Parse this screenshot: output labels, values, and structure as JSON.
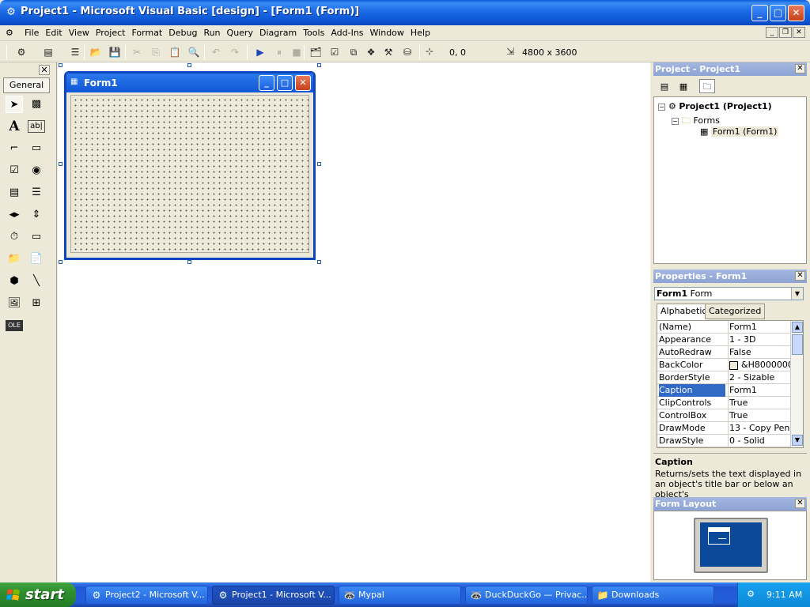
{
  "window": {
    "title": "Project1 - Microsoft Visual Basic [design] - [Form1 (Form)]",
    "controls": {
      "minimize": "_",
      "maximize": "□",
      "close": "✕"
    }
  },
  "menubar": {
    "items": [
      "File",
      "Edit",
      "View",
      "Project",
      "Format",
      "Debug",
      "Run",
      "Query",
      "Diagram",
      "Tools",
      "Add-Ins",
      "Window",
      "Help"
    ],
    "mdi": {
      "minimize": "_",
      "restore": "❐",
      "close": "✕"
    }
  },
  "toolbar": {
    "position": "0, 0",
    "size": "4800 x 3600",
    "buttons": [
      {
        "name": "add-project-icon",
        "glyph": "⚙"
      },
      {
        "name": "add-form-icon",
        "glyph": "▤"
      },
      {
        "name": "menu-editor-icon",
        "glyph": "☰"
      },
      {
        "name": "open-icon",
        "glyph": "📂"
      },
      {
        "name": "save-icon",
        "glyph": "💾"
      },
      {
        "name": "cut-icon",
        "glyph": "✂"
      },
      {
        "name": "copy-icon",
        "glyph": "⎘"
      },
      {
        "name": "paste-icon",
        "glyph": "📋"
      },
      {
        "name": "find-icon",
        "glyph": "🔍"
      },
      {
        "name": "undo-icon",
        "glyph": "↶"
      },
      {
        "name": "redo-icon",
        "glyph": "↷"
      },
      {
        "name": "start-icon",
        "glyph": "▶"
      },
      {
        "name": "break-icon",
        "glyph": "⏸"
      },
      {
        "name": "end-icon",
        "glyph": "■"
      },
      {
        "name": "project-explorer-icon",
        "glyph": "🗂"
      },
      {
        "name": "properties-window-icon",
        "glyph": "☑"
      },
      {
        "name": "form-layout-icon",
        "glyph": "⧉"
      },
      {
        "name": "object-browser-icon",
        "glyph": "❖"
      },
      {
        "name": "toolbox-icon",
        "glyph": "⚒"
      },
      {
        "name": "data-view-icon",
        "glyph": "⛁"
      }
    ]
  },
  "toolbox": {
    "close": "✕",
    "tab": "General",
    "tools": [
      {
        "name": "pointer-icon",
        "glyph": "➤"
      },
      {
        "name": "picturebox-icon",
        "glyph": "▩"
      },
      {
        "name": "label-icon",
        "glyph": "A"
      },
      {
        "name": "textbox-icon",
        "glyph": "ab|"
      },
      {
        "name": "frame-icon",
        "glyph": "⌐"
      },
      {
        "name": "commandbutton-icon",
        "glyph": "▭"
      },
      {
        "name": "checkbox-icon",
        "glyph": "☑"
      },
      {
        "name": "optionbutton-icon",
        "glyph": "◉"
      },
      {
        "name": "combobox-icon",
        "glyph": "▤"
      },
      {
        "name": "listbox-icon",
        "glyph": "☰"
      },
      {
        "name": "hscrollbar-icon",
        "glyph": "◂▸"
      },
      {
        "name": "vscrollbar-icon",
        "glyph": "⇕"
      },
      {
        "name": "timer-icon",
        "glyph": "⏱"
      },
      {
        "name": "drivelistbox-icon",
        "glyph": "▭"
      },
      {
        "name": "dirlistbox-icon",
        "glyph": "📁"
      },
      {
        "name": "filelistbox-icon",
        "glyph": "📄"
      },
      {
        "name": "shape-icon",
        "glyph": "⬢"
      },
      {
        "name": "line-icon",
        "glyph": "╲"
      },
      {
        "name": "image-icon",
        "glyph": "🖼"
      },
      {
        "name": "data-icon",
        "glyph": "⊞"
      },
      {
        "name": "ole-icon",
        "glyph": "OLE"
      }
    ]
  },
  "form_designer": {
    "title": "Form1",
    "controls": {
      "minimize": "_",
      "maximize": "□",
      "close": "✕"
    }
  },
  "project_panel": {
    "title": "Project - Project1",
    "close": "✕",
    "toolbar": [
      {
        "name": "view-code-icon",
        "glyph": "▤"
      },
      {
        "name": "view-object-icon",
        "glyph": "▦"
      },
      {
        "name": "toggle-folders-icon",
        "glyph": "🗀"
      }
    ],
    "tree": {
      "project": "Project1 (Project1)",
      "folder": "Forms",
      "form": "Form1 (Form1)"
    }
  },
  "properties_panel": {
    "title": "Properties - Form1",
    "close": "✕",
    "object_name": "Form1",
    "object_type": "Form",
    "tabs": [
      "Alphabetic",
      "Categorized"
    ],
    "rows": [
      {
        "name": "(Name)",
        "value": "Form1"
      },
      {
        "name": "Appearance",
        "value": "1 - 3D"
      },
      {
        "name": "AutoRedraw",
        "value": "False"
      },
      {
        "name": "BackColor",
        "value": "&H8000000F"
      },
      {
        "name": "BorderStyle",
        "value": "2 - Sizable"
      },
      {
        "name": "Caption",
        "value": "Form1"
      },
      {
        "name": "ClipControls",
        "value": "True"
      },
      {
        "name": "ControlBox",
        "value": "True"
      },
      {
        "name": "DrawMode",
        "value": "13 - Copy Pen"
      },
      {
        "name": "DrawStyle",
        "value": "0 - Solid"
      }
    ],
    "selected": "Caption",
    "description_title": "Caption",
    "description_text": "Returns/sets the text displayed in an object's title bar or below an object's"
  },
  "form_layout_panel": {
    "title": "Form Layout",
    "close": "✕"
  },
  "taskbar": {
    "start": "start",
    "tasks": [
      {
        "label": "Project2 - Microsoft V...",
        "glyph": "⚙"
      },
      {
        "label": "Project1 - Microsoft V...",
        "glyph": "⚙"
      },
      {
        "label": "Mypal",
        "glyph": "🦝"
      },
      {
        "label": "DuckDuckGo — Privac...",
        "glyph": "🦝"
      },
      {
        "label": "Downloads",
        "glyph": "📁"
      }
    ],
    "time": "9:11 AM"
  },
  "colors": {
    "xp_blue": "#0a47c0",
    "panel_title": "#8da3d4",
    "selection": "#316ac5",
    "start_green": "#2f8e2f"
  }
}
